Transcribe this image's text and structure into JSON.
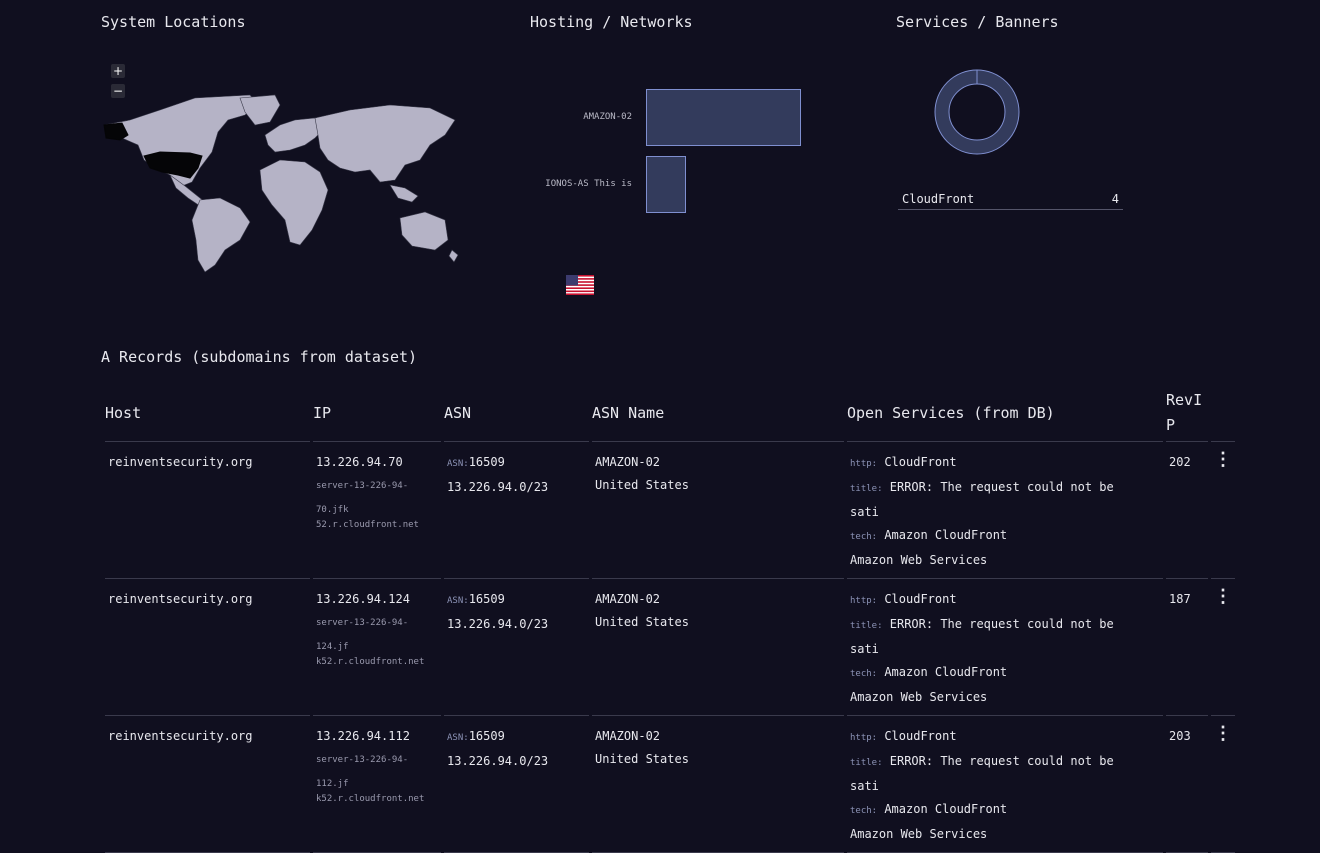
{
  "sections": {
    "locations_title": "System Locations",
    "hosting_title": "Hosting / Networks",
    "services_title": "Services / Banners",
    "records_title": "A Records (subdomains from dataset)"
  },
  "map": {
    "zoom_in": "+",
    "zoom_out": "−",
    "highlighted_country": "United States"
  },
  "hosting_chart": {
    "chart_data": {
      "type": "bar",
      "orientation": "horizontal",
      "categories": [
        "AMAZON-02",
        "IONOS-AS This is"
      ],
      "values": [
        4,
        1
      ]
    }
  },
  "flag": "us-flag",
  "services_chart": {
    "chart_data": {
      "type": "pie",
      "categories": [
        "CloudFront"
      ],
      "values": [
        4
      ]
    },
    "legend": [
      {
        "label": "CloudFront",
        "count": "4"
      }
    ]
  },
  "table": {
    "headers": {
      "host": "Host",
      "ip": "IP",
      "asn": "ASN",
      "asn_name": "ASN Name",
      "services": "Open Services (from DB)",
      "revip_1": "RevI",
      "revip_2": "P"
    },
    "rows": [
      {
        "host": "reinventsecurity.org",
        "ip": "13.226.94.70",
        "ptr_1": "server-13-226-94-70.jfk",
        "ptr_2": "52.r.cloudfront.net",
        "asn_label": "ASN:",
        "asn": "16509",
        "netblock": "13.226.94.0/23",
        "asn_name": "AMAZON-02",
        "country": "United States",
        "http_label": "http:",
        "http": "CloudFront",
        "title_label": "title:",
        "title_1": "ERROR: The request could not be",
        "title_2": "sati",
        "tech_label": "tech:",
        "tech": "Amazon CloudFront",
        "tech_2": "Amazon Web Services",
        "revip": "202",
        "menu": "⋮"
      },
      {
        "host": "reinventsecurity.org",
        "ip": "13.226.94.124",
        "ptr_1": "server-13-226-94-124.jf",
        "ptr_2": "k52.r.cloudfront.net",
        "asn_label": "ASN:",
        "asn": "16509",
        "netblock": "13.226.94.0/23",
        "asn_name": "AMAZON-02",
        "country": "United States",
        "http_label": "http:",
        "http": "CloudFront",
        "title_label": "title:",
        "title_1": "ERROR: The request could not be",
        "title_2": "sati",
        "tech_label": "tech:",
        "tech": "Amazon CloudFront",
        "tech_2": "Amazon Web Services",
        "revip": "187",
        "menu": "⋮"
      },
      {
        "host": "reinventsecurity.org",
        "ip": "13.226.94.112",
        "ptr_1": "server-13-226-94-112.jf",
        "ptr_2": "k52.r.cloudfront.net",
        "asn_label": "ASN:",
        "asn": "16509",
        "netblock": "13.226.94.0/23",
        "asn_name": "AMAZON-02",
        "country": "United States",
        "http_label": "http:",
        "http": "CloudFront",
        "title_label": "title:",
        "title_1": "ERROR: The request could not be",
        "title_2": "sati",
        "tech_label": "tech:",
        "tech": "Amazon CloudFront",
        "tech_2": "Amazon Web Services",
        "revip": "203",
        "menu": "⋮"
      }
    ]
  }
}
